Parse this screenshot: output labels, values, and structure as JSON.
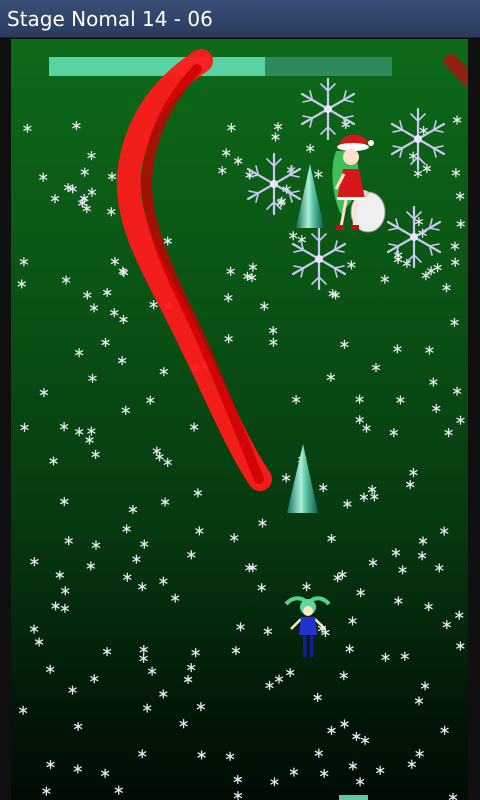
{
  "window": {
    "title": "Stage Nomal 14 - 06"
  },
  "boss_health": {
    "fraction": 0.63,
    "fill_color": "#59d3a3",
    "track_color": "#2e8a5c"
  },
  "colors": {
    "laser": "#ee0000",
    "bg_top": "#0d6a18",
    "bg_bottom": "#010c03"
  },
  "sprites": {
    "boss": "santa-girl-with-sack",
    "player": "green-haired-girl-blue-outfit",
    "hazard": "ice-cone-tree",
    "orbiter": "large-snowflake"
  }
}
